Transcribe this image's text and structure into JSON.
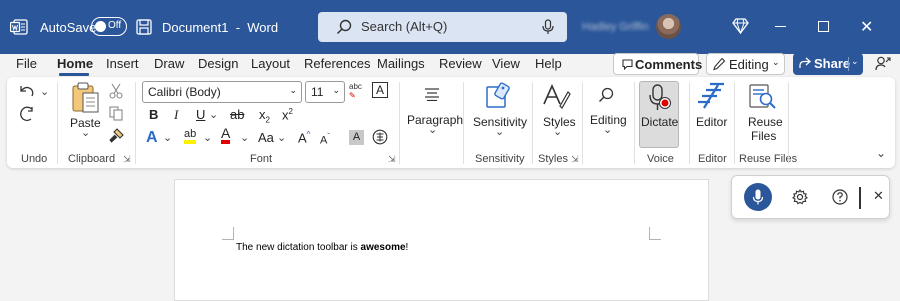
{
  "titlebar": {
    "autosave_label": "AutoSave",
    "autosave_state": "Off",
    "document_title": "Document1  -  Word",
    "search_placeholder": "Search (Alt+Q)",
    "user_name": "Hadley Griffin",
    "accent_color": "#2b579a"
  },
  "menu": {
    "tabs": [
      "File",
      "Home",
      "Insert",
      "Draw",
      "Design",
      "Layout",
      "References",
      "Mailings",
      "Review",
      "View",
      "Help"
    ],
    "active_tab": "Home",
    "comments_label": "Comments",
    "editing_label": "Editing",
    "share_label": "Share"
  },
  "ribbon": {
    "font_name": "Calibri (Body)",
    "font_size": "11",
    "paste_label": "Paste",
    "paragraph_label": "Paragraph",
    "sensitivity_label": "Sensitivity",
    "styles_label": "Styles",
    "editing_label": "Editing",
    "dictate_label": "Dictate",
    "editor_label": "Editor",
    "reuse_files_label_1": "Reuse",
    "reuse_files_label_2": "Files",
    "format_glyphs": {
      "bold": "B",
      "italic": "I",
      "underline": "U",
      "strikethrough": "ab",
      "subscript": "x",
      "superscript": "x",
      "sub_mark": "2",
      "sup_mark": "2",
      "change_case": "Aa",
      "grow": "A",
      "shrink": "A",
      "clear_formatting_abc": "abc",
      "char_border": "A",
      "char_shading": "A",
      "text_effects": "A",
      "highlight_letter": "ab",
      "font_color": "A"
    },
    "groups": {
      "undo": "Undo",
      "clipboard": "Clipboard",
      "font": "Font",
      "paragraph": "Paragraph",
      "sensitivity": "Sensitivity",
      "styles": "Styles",
      "voice": "Voice",
      "editor": "Editor",
      "reuse_files": "Reuse Files"
    }
  },
  "document": {
    "text_before": "The new dictation toolbar is ",
    "text_bold": "awesome",
    "text_after": "!"
  }
}
